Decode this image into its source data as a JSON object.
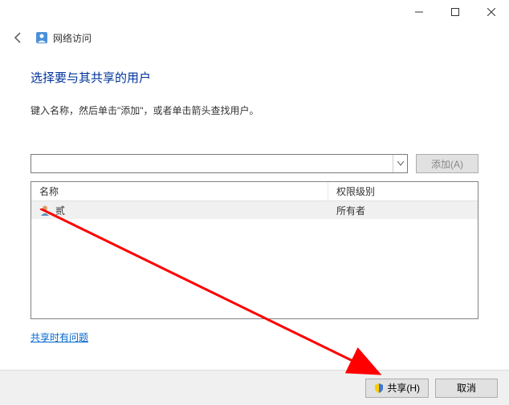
{
  "window": {
    "title": "网络访问"
  },
  "main": {
    "heading": "选择要与其共享的用户",
    "instruction": "键入名称，然后单击\"添加\"，或者单击箭头查找用户。",
    "combo_value": "",
    "add_label": "添加(A)"
  },
  "table": {
    "columns": {
      "name": "名称",
      "permission": "权限级别"
    },
    "rows": [
      {
        "user": "贰",
        "permission": "所有者"
      }
    ]
  },
  "link": {
    "trouble": "共享时有问题"
  },
  "footer": {
    "share": "共享(H)",
    "cancel": "取消"
  }
}
